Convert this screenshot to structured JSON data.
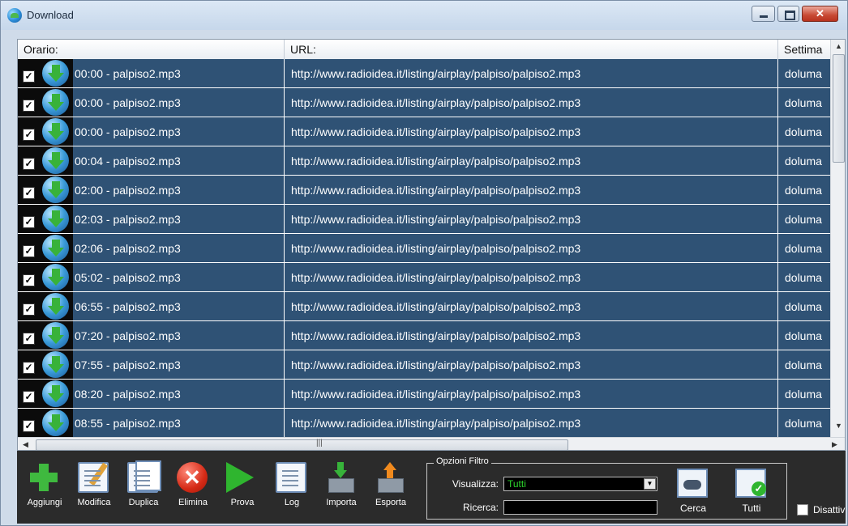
{
  "window": {
    "title": "Download",
    "controls": {
      "minimize_icon": "minimize-icon",
      "maximize_icon": "maximize-icon",
      "close_symbol": "✕"
    }
  },
  "grid": {
    "columns": [
      "Orario:",
      "URL:",
      "Settima"
    ],
    "rows": [
      {
        "time": "00:00 - palpiso2.mp3",
        "url": "http://www.radioidea.it/listing/airplay/palpiso/palpiso2.mp3",
        "week": "doluma",
        "checked": true
      },
      {
        "time": "00:00 - palpiso2.mp3",
        "url": "http://www.radioidea.it/listing/airplay/palpiso/palpiso2.mp3",
        "week": "doluma",
        "checked": true
      },
      {
        "time": "00:00 - palpiso2.mp3",
        "url": "http://www.radioidea.it/listing/airplay/palpiso/palpiso2.mp3",
        "week": "doluma",
        "checked": true
      },
      {
        "time": "00:04 - palpiso2.mp3",
        "url": "http://www.radioidea.it/listing/airplay/palpiso/palpiso2.mp3",
        "week": "doluma",
        "checked": true
      },
      {
        "time": "02:00 - palpiso2.mp3",
        "url": "http://www.radioidea.it/listing/airplay/palpiso/palpiso2.mp3",
        "week": "doluma",
        "checked": true
      },
      {
        "time": "02:03 - palpiso2.mp3",
        "url": "http://www.radioidea.it/listing/airplay/palpiso/palpiso2.mp3",
        "week": "doluma",
        "checked": true
      },
      {
        "time": "02:06 - palpiso2.mp3",
        "url": "http://www.radioidea.it/listing/airplay/palpiso/palpiso2.mp3",
        "week": "doluma",
        "checked": true
      },
      {
        "time": "05:02 - palpiso2.mp3",
        "url": "http://www.radioidea.it/listing/airplay/palpiso/palpiso2.mp3",
        "week": "doluma",
        "checked": true
      },
      {
        "time": "06:55 - palpiso2.mp3",
        "url": "http://www.radioidea.it/listing/airplay/palpiso/palpiso2.mp3",
        "week": "doluma",
        "checked": true
      },
      {
        "time": "07:20 - palpiso2.mp3",
        "url": "http://www.radioidea.it/listing/airplay/palpiso/palpiso2.mp3",
        "week": "doluma",
        "checked": true
      },
      {
        "time": "07:55 - palpiso2.mp3",
        "url": "http://www.radioidea.it/listing/airplay/palpiso/palpiso2.mp3",
        "week": "doluma",
        "checked": true
      },
      {
        "time": "08:20 - palpiso2.mp3",
        "url": "http://www.radioidea.it/listing/airplay/palpiso/palpiso2.mp3",
        "week": "doluma",
        "checked": true
      },
      {
        "time": "08:55 - palpiso2.mp3",
        "url": "http://www.radioidea.it/listing/airplay/palpiso/palpiso2.mp3",
        "week": "doluma",
        "checked": true
      }
    ],
    "row_colors": {
      "background": "#2f5275",
      "icon_cell": "#0b0b0b",
      "text": "#ffffff"
    }
  },
  "toolbar": {
    "buttons": [
      {
        "label": "Aggiungi",
        "icon": "add-icon"
      },
      {
        "label": "Modifica",
        "icon": "edit-icon"
      },
      {
        "label": "Duplica",
        "icon": "duplicate-icon"
      },
      {
        "label": "Elimina",
        "icon": "delete-icon"
      },
      {
        "label": "Prova",
        "icon": "play-icon"
      },
      {
        "label": "Log",
        "icon": "log-icon"
      },
      {
        "label": "Importa",
        "icon": "import-icon"
      },
      {
        "label": "Esporta",
        "icon": "export-icon"
      }
    ],
    "filter": {
      "title": "Opzioni Filtro",
      "show_label": "Visualizza:",
      "show_value": "Tutti",
      "search_label": "Ricerca:",
      "search_value": "",
      "search_button": "Cerca",
      "all_button": "Tutti"
    },
    "disable_label": "Disattiv",
    "disable_checked": false
  }
}
